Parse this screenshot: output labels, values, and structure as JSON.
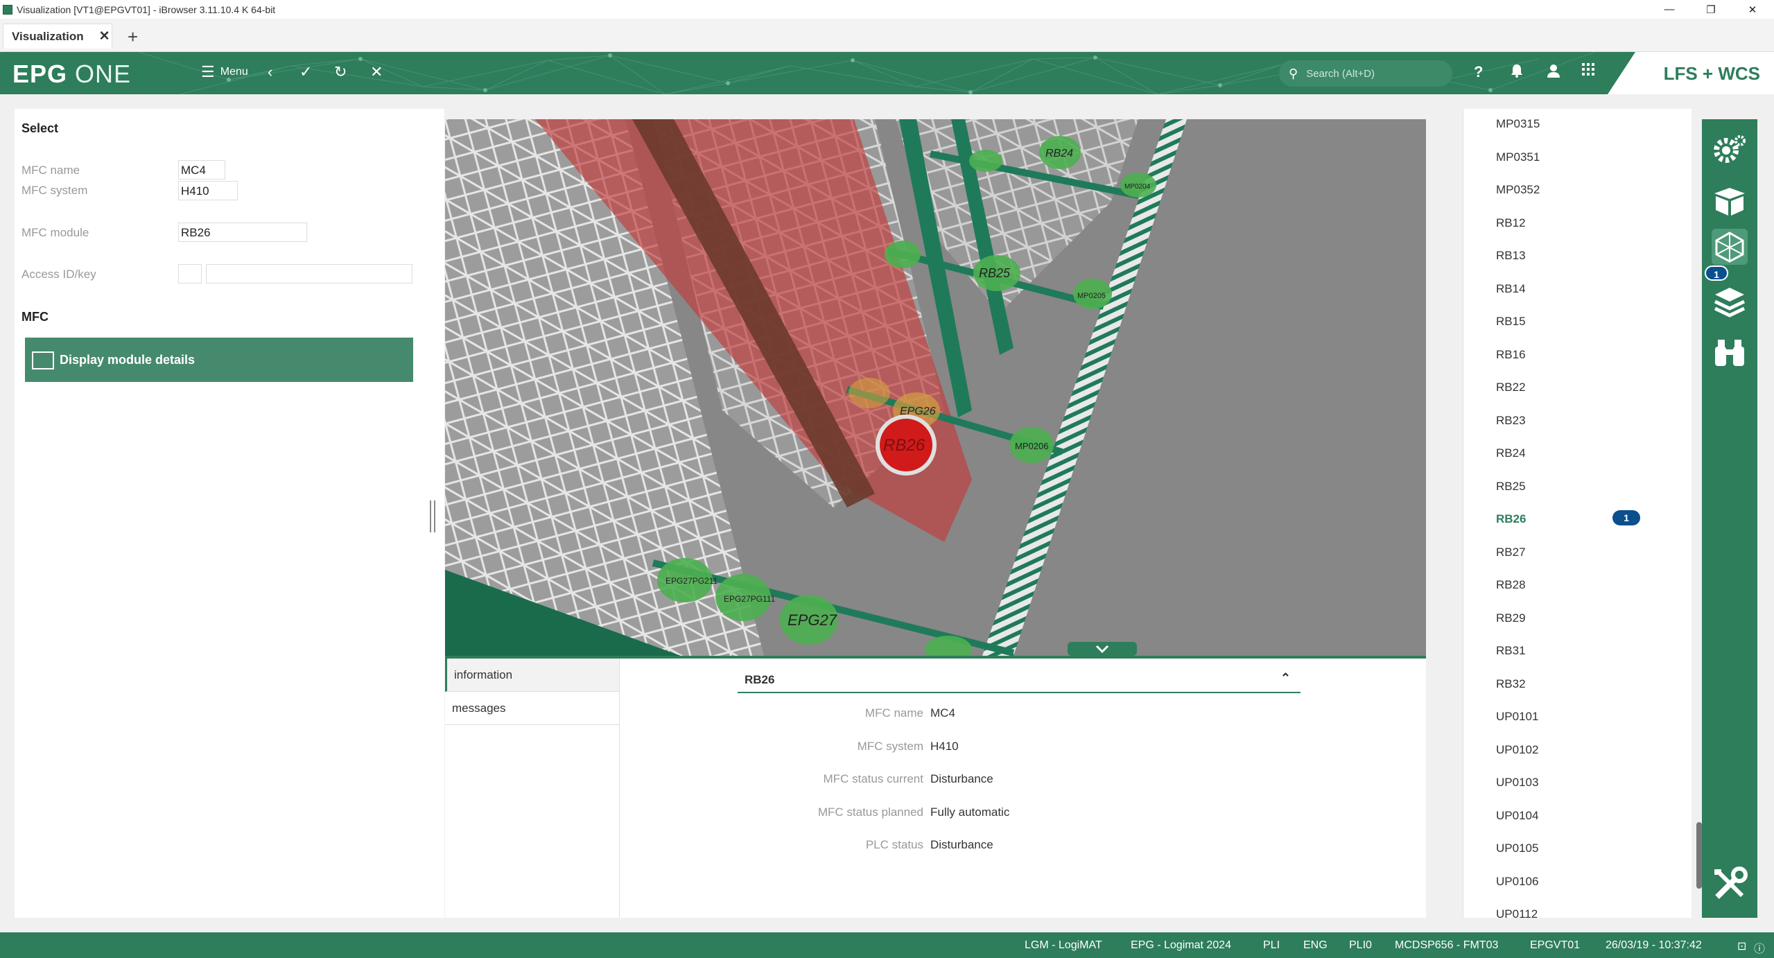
{
  "window": {
    "title": "Visualization [VT1@EPGVT01] - iBrowser 3.11.10.4 K 64-bit"
  },
  "tab": {
    "label": "Visualization",
    "new_tab": "+"
  },
  "header": {
    "logo_a": "EPG",
    "logo_b": "ONE",
    "menu_label": "Menu",
    "search_placeholder": "Search (Alt+D)",
    "brand": "LFS + WCS"
  },
  "left": {
    "title": "Select",
    "fields": [
      {
        "label": "MFC name",
        "value": "MC4"
      },
      {
        "label": "MFC system",
        "value": "H410"
      },
      {
        "label": "MFC module",
        "value": "RB26"
      },
      {
        "label": "Access ID/key",
        "value": ""
      }
    ],
    "section": "MFC",
    "display_button": "Display module details"
  },
  "scene": {
    "labels": [
      "RB24",
      "RB25",
      "RB26",
      "EPG26",
      "MP0204",
      "MP0205",
      "MP0206",
      "EPG27",
      "EPG27PG211",
      "EPG27PG111"
    ],
    "highlight_color": "#c33b3b",
    "conveyor_color": "#1f7a5a"
  },
  "bottom": {
    "tabs": [
      "information",
      "messages"
    ],
    "header": "RB26",
    "rows": [
      {
        "key": "MFC name",
        "value": "MC4"
      },
      {
        "key": "MFC system",
        "value": "H410"
      },
      {
        "key": "MFC status current",
        "value": "Disturbance"
      },
      {
        "key": "MFC status planned",
        "value": "Fully automatic"
      },
      {
        "key": "PLC status",
        "value": "Disturbance"
      }
    ]
  },
  "module_list": {
    "items": [
      "MP0315",
      "MP0351",
      "MP0352",
      "RB12",
      "RB13",
      "RB14",
      "RB15",
      "RB16",
      "RB22",
      "RB23",
      "RB24",
      "RB25",
      "RB26",
      "RB27",
      "RB28",
      "RB29",
      "RB31",
      "RB32",
      "UP0101",
      "UP0102",
      "UP0103",
      "UP0104",
      "UP0105",
      "UP0106",
      "UP0112"
    ],
    "selected": "RB26",
    "selected_badge": "1"
  },
  "toolbar": {
    "layers_badge": "1",
    "icons": [
      "settings-icon",
      "box-icon",
      "model-3d-icon",
      "layers-icon",
      "binoculars-icon",
      "tools-icon"
    ]
  },
  "status": {
    "items": [
      "LGM - LogiMAT",
      "EPG - Logimat 2024",
      "PLI",
      "ENG",
      "PLI0",
      "MCDSP656 - FMT03",
      "EPGVT01",
      "26/03/19 - 10:37:42"
    ]
  }
}
